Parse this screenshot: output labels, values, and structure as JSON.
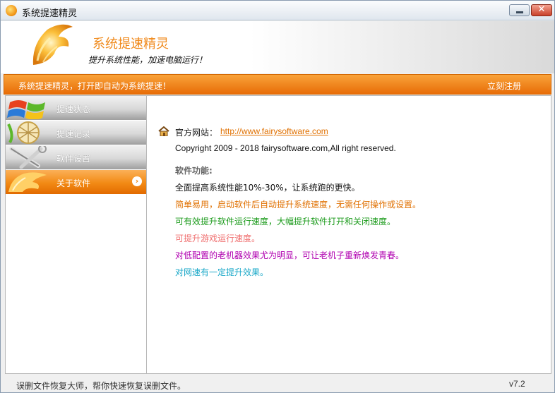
{
  "window": {
    "title": "系统提速精灵"
  },
  "banner": {
    "title": "系统提速精灵",
    "subtitle": "提升系统性能，加速电脑运行！"
  },
  "orange_bar": {
    "message": "系统提速精灵，打开即自动为系统提速！",
    "register_label": "立刻注册"
  },
  "sidebar": {
    "items": [
      {
        "label": "提速状态",
        "icon": "windows-flag-icon",
        "active": false
      },
      {
        "label": "提速记录",
        "icon": "record-net-icon",
        "active": false
      },
      {
        "label": "软件设置",
        "icon": "wrench-tools-icon",
        "active": false
      },
      {
        "label": "关于软件",
        "icon": "fireball-icon",
        "active": true
      }
    ]
  },
  "about": {
    "site_label": "官方网站：",
    "site_url": "http://www.fairysoftware.com",
    "copyright": "Copyright 2009 - 2018 fairysoftware.com,All right reserved.",
    "features_title": "软件功能:",
    "features": [
      {
        "text": "全面提高系统性能10%-30%，让系统跑的更快。",
        "color": "#111111"
      },
      {
        "text": "简单易用，启动软件后自动提升系统速度，无需任何操作或设置。",
        "color": "#e07000"
      },
      {
        "text": "可有效提升软件运行速度，大幅提升软件打开和关闭速度。",
        "color": "#1a9a1a"
      },
      {
        "text": "可提升游戏运行速度。",
        "color": "#f07070"
      },
      {
        "text": "对低配置的老机器效果尤为明显，可让老机子重新焕发青春。",
        "color": "#b000b0"
      },
      {
        "text": "对网速有一定提升效果。",
        "color": "#1aa8c8"
      }
    ]
  },
  "statusbar": {
    "text": "误删文件恢复大师，帮你快速恢复误删文件。",
    "version": "v7.2"
  },
  "colors": {
    "accent": "#f08a14",
    "link": "#e07000"
  }
}
